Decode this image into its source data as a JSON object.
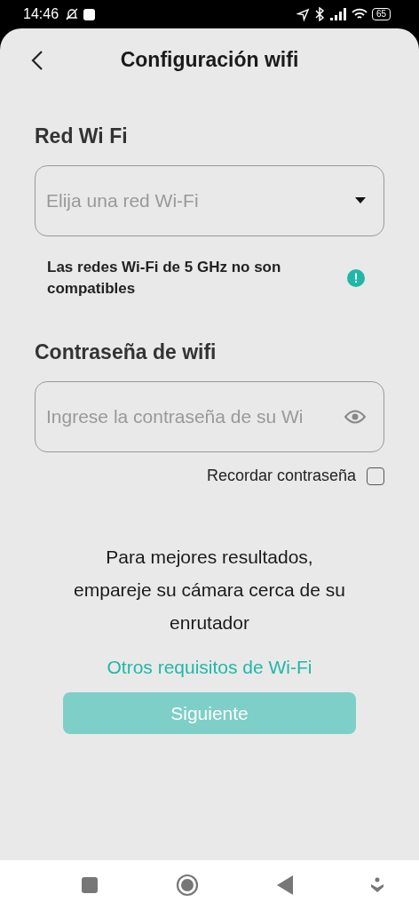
{
  "status_bar": {
    "time": "14:46",
    "battery": "65"
  },
  "header": {
    "title": "Configuración wifi"
  },
  "network": {
    "label": "Red Wi Fi",
    "placeholder": "Elija una red Wi-Fi",
    "note": "Las redes Wi-Fi de 5 GHz no son compatibles"
  },
  "password": {
    "label": "Contraseña de wifi",
    "placeholder": "Ingrese la contraseña de su Wi",
    "remember": {
      "label": "Recordar contraseña",
      "checked": false
    }
  },
  "tip": "Para mejores resultados, empareje su cámara cerca de su enrutador",
  "link": "Otros requisitos de Wi-Fi",
  "next_button": {
    "label": "Siguiente",
    "disabled": true
  }
}
